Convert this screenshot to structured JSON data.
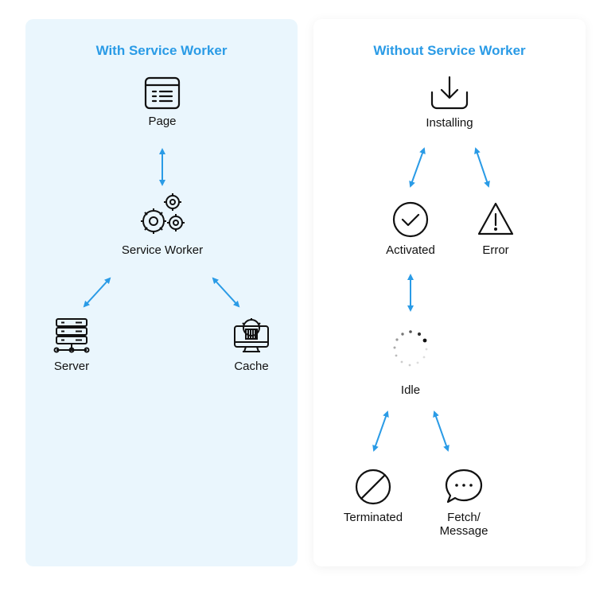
{
  "left_panel": {
    "title": "With Service Worker",
    "nodes": {
      "page": {
        "label": "Page",
        "icon": "browser-page-icon"
      },
      "service_worker": {
        "label": "Service Worker",
        "icon": "gears-icon"
      },
      "server": {
        "label": "Server",
        "icon": "server-icon"
      },
      "cache": {
        "label": "Cache",
        "icon": "cache-monitor-icon"
      }
    }
  },
  "right_panel": {
    "title": "Without Service Worker",
    "nodes": {
      "installing": {
        "label": "Installing",
        "icon": "download-icon"
      },
      "activated": {
        "label": "Activated",
        "icon": "check-circle-icon"
      },
      "error": {
        "label": "Error",
        "icon": "warning-triangle-icon"
      },
      "idle": {
        "label": "Idle",
        "icon": "spinner-icon"
      },
      "terminated": {
        "label": "Terminated",
        "icon": "prohibited-icon"
      },
      "fetch_message": {
        "label_line1": "Fetch/",
        "label_line2": "Message",
        "icon": "chat-bubble-icon"
      }
    }
  },
  "colors": {
    "accent": "#2a9be6",
    "left_panel_bg": "#eaf6fd",
    "right_panel_bg": "#ffffff",
    "icon": "#111111"
  }
}
